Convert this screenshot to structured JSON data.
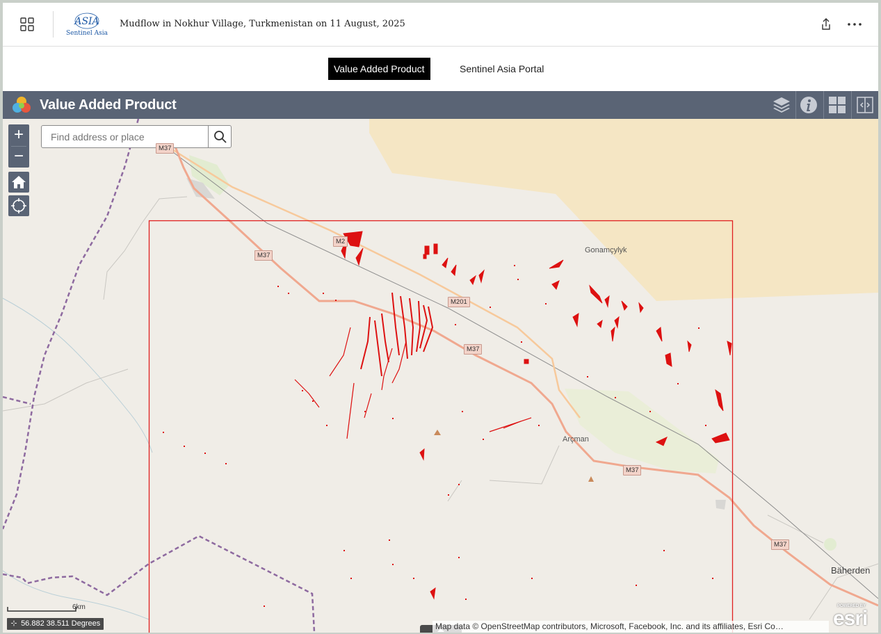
{
  "header": {
    "title": "Mudflow in Nokhur Village, Turkmenistan on 11 August, 2025",
    "logo_text": "Sentinel Asia",
    "logo_mark": "ASIA",
    "apps_icon": "grid-icon",
    "share_icon": "share-icon",
    "more_icon": "more-horizontal-icon"
  },
  "tabs": [
    {
      "label": "Value Added Product",
      "active": true
    },
    {
      "label": "Sentinel Asia Portal",
      "active": false
    }
  ],
  "appbar": {
    "title": "Value Added Product",
    "buttons": [
      "layers-icon",
      "info-icon",
      "basemap-gallery-icon",
      "swipe-icon"
    ]
  },
  "map": {
    "search": {
      "placeholder": "Find address or place"
    },
    "zoom_in": "+",
    "zoom_out": "−",
    "labels": {
      "gonamcylyk": "Gonamçylyk",
      "arcman": "Arçman",
      "baherden": "Bäherden"
    },
    "roads": {
      "m37_a": "M37",
      "m37_b": "M37",
      "m37_c": "M37",
      "m37_d": "M37",
      "m201_a": "M201",
      "m201_b": "M2",
      "m37_top": "M37"
    },
    "scale_label": "6km",
    "coordinates": "56.882 38.511 Degrees",
    "attribution": "Map data © OpenStreetMap contributors, Microsoft, Facebook, Inc. and its affiliates, Esri Co…",
    "esri_powered": "POWERED BY",
    "esri_word": "esri",
    "colors": {
      "analysis_extent": "#e02020",
      "mudflow_pixels": "#dd1111",
      "desert": "#f5e6c4",
      "boundary": "#8e6aa0"
    }
  }
}
